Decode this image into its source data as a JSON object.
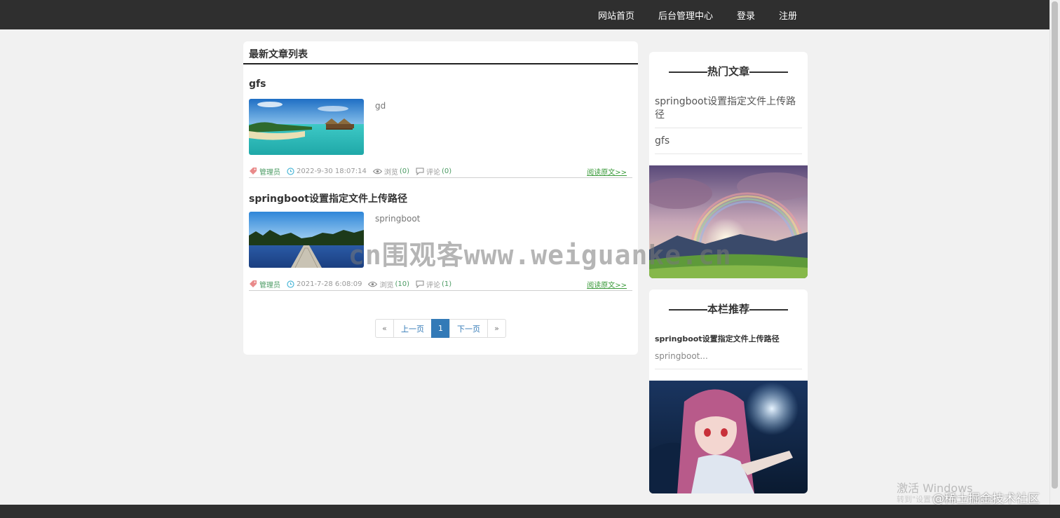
{
  "nav": {
    "items": [
      "网站首页",
      "后台管理中心",
      "登录",
      "注册"
    ]
  },
  "main": {
    "title": "最新文章列表",
    "articles": [
      {
        "title": "gfs",
        "summary": "gd",
        "author": "管理员",
        "date": "2022-9-30 18:07:14",
        "views_label": "浏览",
        "views": "(0)",
        "comments_label": "评论",
        "comments": "(0)",
        "read_more": "阅读原文>>",
        "thumb": "tropical-beach-image"
      },
      {
        "title": "springboot设置指定文件上传路径",
        "summary": "springboot",
        "author": "管理员",
        "date": "2021-7-28 6:08:09",
        "views_label": "浏览",
        "views": "(10)",
        "comments_label": "评论",
        "comments": "(1)",
        "read_more": "阅读原文>>",
        "thumb": "lake-pier-image"
      }
    ]
  },
  "pagination": {
    "first": "«",
    "prev": "上一页",
    "current": "1",
    "next": "下一页",
    "last": "»"
  },
  "sidebar": {
    "hot": {
      "title": "热门文章",
      "items": [
        "springboot设置指定文件上传路径",
        "gfs"
      ],
      "image": "rainbow-landscape-image"
    },
    "recommend": {
      "title": "本栏推荐",
      "item_title": "springboot设置指定文件上传路径",
      "item_summary": "springboot...",
      "image": "anime-girl-image"
    }
  },
  "overlays": {
    "watermark": "cn围观客www.weiguanke.cn",
    "windows_activation": "激活 Windows",
    "windows_activation_sub": "转到\"设置\"以激活 Windows。",
    "juejin": "@稀土掘金技术社区"
  },
  "colors": {
    "topbar": "#2f2f2f",
    "page_bg": "#f1f1f1",
    "link_blue": "#337ab7",
    "green": "#4a9a62"
  }
}
